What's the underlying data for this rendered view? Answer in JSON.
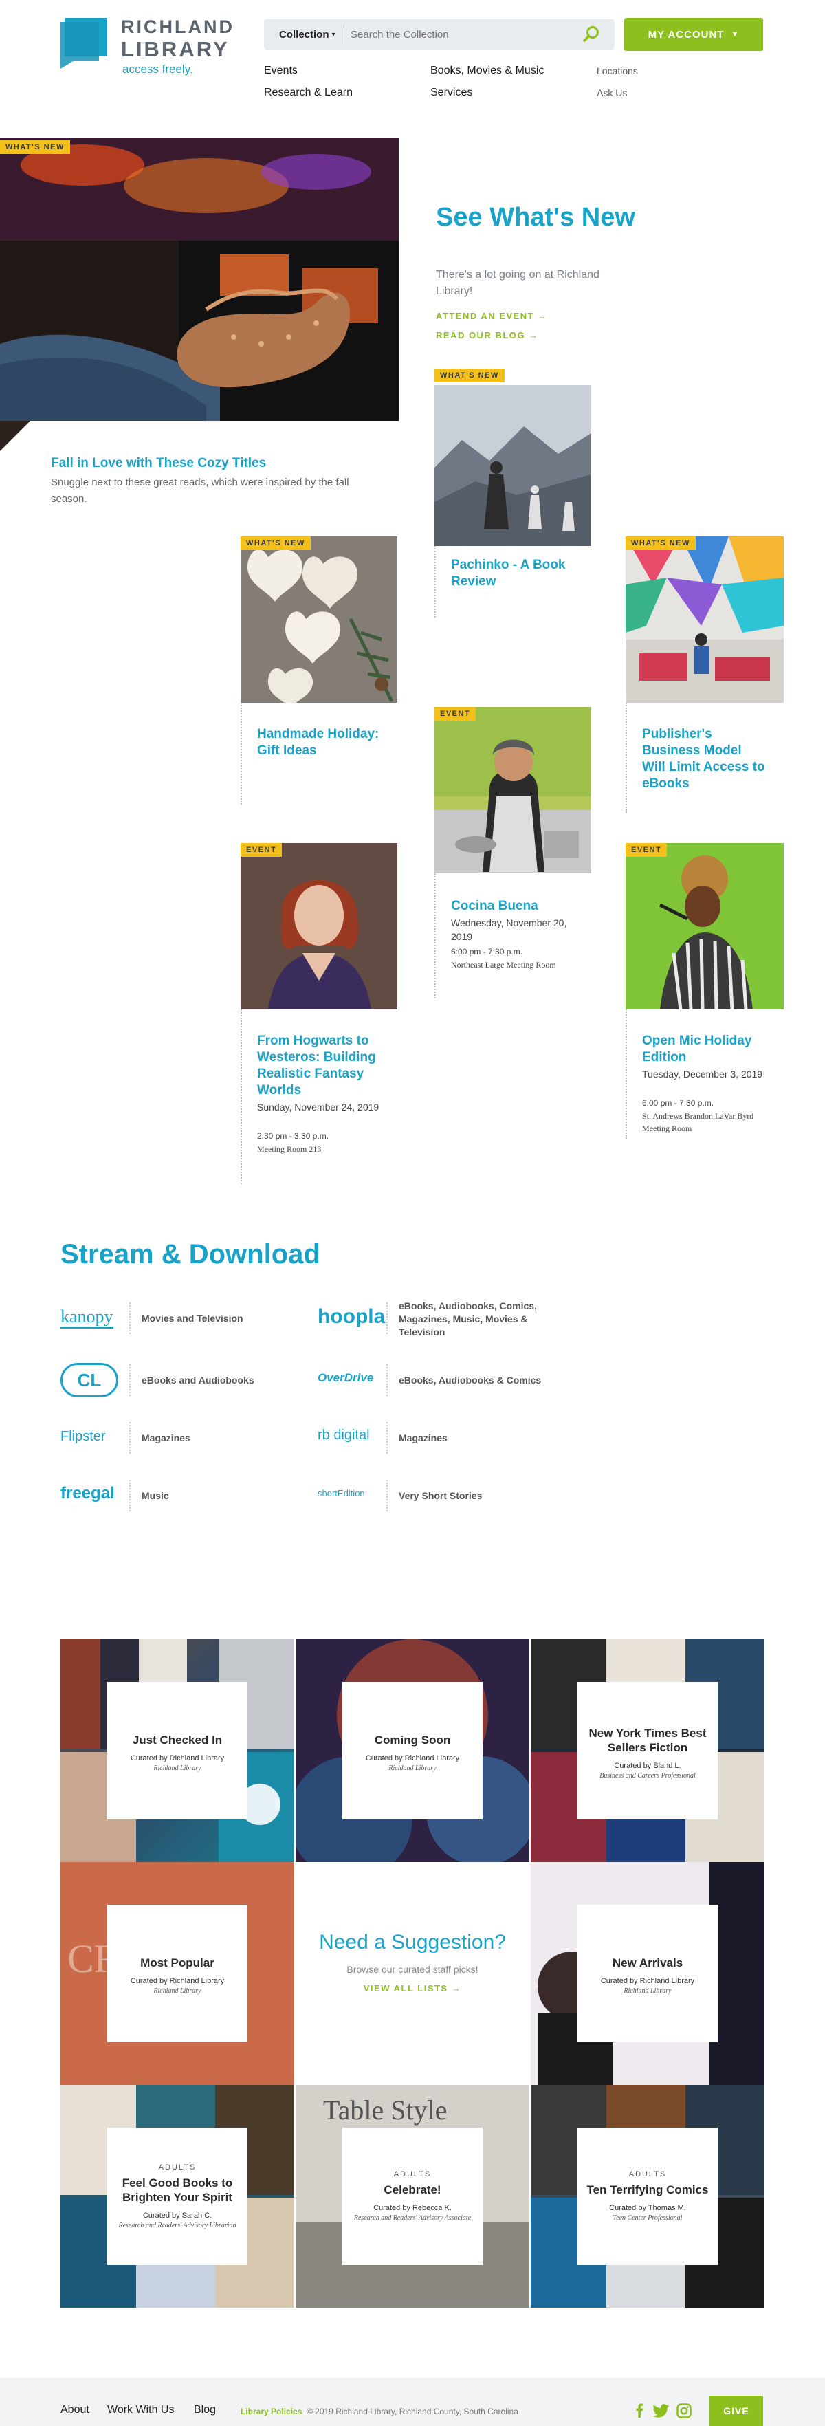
{
  "header": {
    "logo_line1": "RICHLAND",
    "logo_line2": "LIBRARY",
    "logo_tagline": "access freely.",
    "collection_label": "Collection",
    "search_placeholder": "Search the Collection",
    "account_label": "MY ACCOUNT",
    "nav": {
      "events": "Events",
      "books": "Books, Movies & Music",
      "locations": "Locations",
      "research": "Research & Learn",
      "services": "Services",
      "ask": "Ask Us"
    }
  },
  "hero": {
    "tag": "WHAT'S NEW",
    "title": "See What's New",
    "subtitle": "There's a lot going on at Richland Library!",
    "link_events": "ATTEND AN EVENT →",
    "link_blog": "READ OUR BLOG →",
    "feature_title": "Fall in Love with These Cozy Titles",
    "feature_desc": "Snuggle next to these great reads, which were inspired by the fall season."
  },
  "cards": {
    "pachinko": {
      "tag": "WHAT'S NEW",
      "title": "Pachinko - A Book Review"
    },
    "handmade": {
      "tag": "WHAT'S NEW",
      "title": "Handmade Holiday: Gift Ideas"
    },
    "publisher": {
      "tag": "WHAT'S NEW",
      "title": "Publisher's Business Model Will Limit Access to eBooks"
    },
    "cocina": {
      "tag": "EVENT",
      "title": "Cocina Buena",
      "date": "Wednesday, November 20, 2019",
      "time": "6:00 pm - 7:30 p.m.",
      "location": "Northeast Large Meeting Room"
    },
    "hogwarts": {
      "tag": "EVENT",
      "title": "From Hogwarts to Westeros: Building Realistic Fantasy Worlds",
      "date": "Sunday, November 24, 2019",
      "time": "2:30 pm - 3:30 p.m.",
      "location": "Meeting Room 213"
    },
    "openmic": {
      "tag": "EVENT",
      "title": "Open Mic Holiday Edition",
      "date": "Tuesday, December 3, 2019",
      "time": "6:00 pm - 7:30 p.m.",
      "location": "St. Andrews Brandon LaVar Byrd Meeting Room"
    }
  },
  "stream": {
    "title": "Stream & Download",
    "services": [
      {
        "logo": "kanopy",
        "desc": "Movies and Television"
      },
      {
        "logo": "hoopla",
        "desc": "eBooks, Audiobooks, Comics, Magazines, Music, Movies & Television"
      },
      {
        "logo": "CL",
        "desc": "eBooks and Audiobooks"
      },
      {
        "logo": "OverDrive",
        "desc": "eBooks, Audiobooks & Comics"
      },
      {
        "logo": "Flipster",
        "desc": "Magazines"
      },
      {
        "logo": "rb digital",
        "desc": "Magazines"
      },
      {
        "logo": "freegal",
        "desc": "Music"
      },
      {
        "logo": "shortEdition",
        "desc": "Very Short Stories"
      }
    ]
  },
  "lists": {
    "tiles": [
      {
        "kicker": "",
        "title": "Just Checked In",
        "curator": "Curated by Richland Library",
        "role": "Richland Library"
      },
      {
        "kicker": "",
        "title": "Coming Soon",
        "curator": "Curated by Richland Library",
        "role": "Richland Library"
      },
      {
        "kicker": "",
        "title": "New York Times Best Sellers Fiction",
        "curator": "Curated by Bland L.",
        "role": "Business and Careers Professional"
      },
      {
        "kicker": "",
        "title": "Most Popular",
        "curator": "Curated by Richland Library",
        "role": "Richland Library"
      },
      {
        "kicker": "",
        "title": "New Arrivals",
        "curator": "Curated by Richland Library",
        "role": "Richland Library"
      },
      {
        "kicker": "ADULTS",
        "title": "Feel Good Books to Brighten Your Spirit",
        "curator": "Curated by Sarah C.",
        "role": "Research and Readers' Advisory Librarian"
      },
      {
        "kicker": "ADULTS",
        "title": "Celebrate!",
        "curator": "Curated by Rebecca K.",
        "role": "Research and Readers' Advisory Associate"
      },
      {
        "kicker": "ADULTS",
        "title": "Ten Terrifying Comics",
        "curator": "Curated by Thomas M.",
        "role": "Teen Center Professional"
      }
    ],
    "suggestion": {
      "title": "Need a Suggestion?",
      "subtitle": "Browse our curated staff picks!",
      "link": "VIEW ALL LISTS →"
    }
  },
  "footer": {
    "about": "About",
    "work": "Work With Us",
    "blog": "Blog",
    "policies": "Library Policies",
    "copyright": "© 2019 Richland Library, Richland County, South Carolina",
    "give": "GIVE"
  },
  "colors": {
    "brand_blue": "#1aa3c8",
    "accent_green": "#8dbf1e",
    "tag_yellow": "#f3c01a"
  }
}
